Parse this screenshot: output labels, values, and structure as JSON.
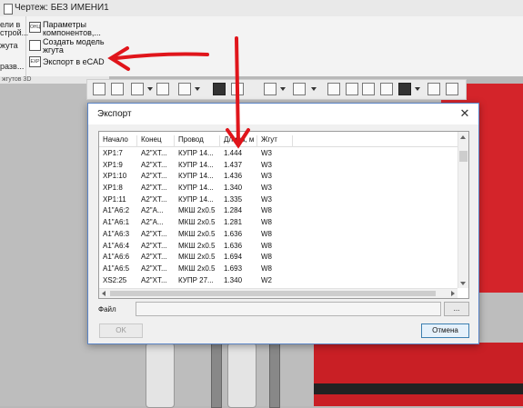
{
  "window": {
    "title": "Чертеж: БЕЗ ИМЕНИ1"
  },
  "ribbon": {
    "left_fragments": [
      "ели в",
      "строй...",
      "жута",
      "разв..."
    ],
    "items": [
      {
        "icon": "ОНЦ",
        "label": "Параметры компонентов,..."
      },
      {
        "icon": "",
        "label": "Создать модель жгута"
      },
      {
        "icon": "EXP",
        "label": "Экспорт в eCAD"
      }
    ],
    "group_label": "жгутов 3D"
  },
  "dialog": {
    "title": "Экспорт",
    "close_glyph": "✕",
    "columns": [
      "Начало",
      "Конец",
      "Провод",
      "Длина, м",
      "Жгут"
    ],
    "rows": [
      [
        "XP1:7",
        "A2\"XT...",
        "КУПР 14...",
        "1.444",
        "W3"
      ],
      [
        "XP1:9",
        "A2\"XT...",
        "КУПР 14...",
        "1.437",
        "W3"
      ],
      [
        "XP1:10",
        "A2\"XT...",
        "КУПР 14...",
        "1.436",
        "W3"
      ],
      [
        "XP1:8",
        "A2\"XT...",
        "КУПР 14...",
        "1.340",
        "W3"
      ],
      [
        "XP1:11",
        "A2\"XT...",
        "КУПР 14...",
        "1.335",
        "W3"
      ],
      [
        "A1\"A6:2",
        "A2\"A...",
        "МКШ 2x0.5",
        "1.284",
        "W8"
      ],
      [
        "A1\"A6:1",
        "A2\"A...",
        "МКШ 2x0.5",
        "1.281",
        "W8"
      ],
      [
        "A1\"A6:3",
        "A2\"XT...",
        "МКШ 2x0.5",
        "1.636",
        "W8"
      ],
      [
        "A1\"A6:4",
        "A2\"XT...",
        "МКШ 2x0.5",
        "1.636",
        "W8"
      ],
      [
        "A1\"A6:6",
        "A2\"XT...",
        "МКШ 2x0.5",
        "1.694",
        "W8"
      ],
      [
        "A1\"A6:5",
        "A2\"XT...",
        "МКШ 2x0.5",
        "1.693",
        "W8"
      ],
      [
        "XS2:25",
        "A2\"XT...",
        "КУПР 27...",
        "1.340",
        "W2"
      ]
    ],
    "file_label": "Файл",
    "file_value": "",
    "browse_label": "...",
    "ok_label": "OK",
    "cancel_label": "Отмена"
  },
  "colors": {
    "annotation_arrow": "#e0151b",
    "dialog_border": "#5a84c6",
    "cancel_border": "#3c7fb1",
    "viewport_red": "#d4242a"
  },
  "icons": [
    "document-icon",
    "close-icon",
    "chevron-down-icon",
    "cube-icon",
    "filter-icon",
    "eye-icon",
    "camera-icon"
  ]
}
